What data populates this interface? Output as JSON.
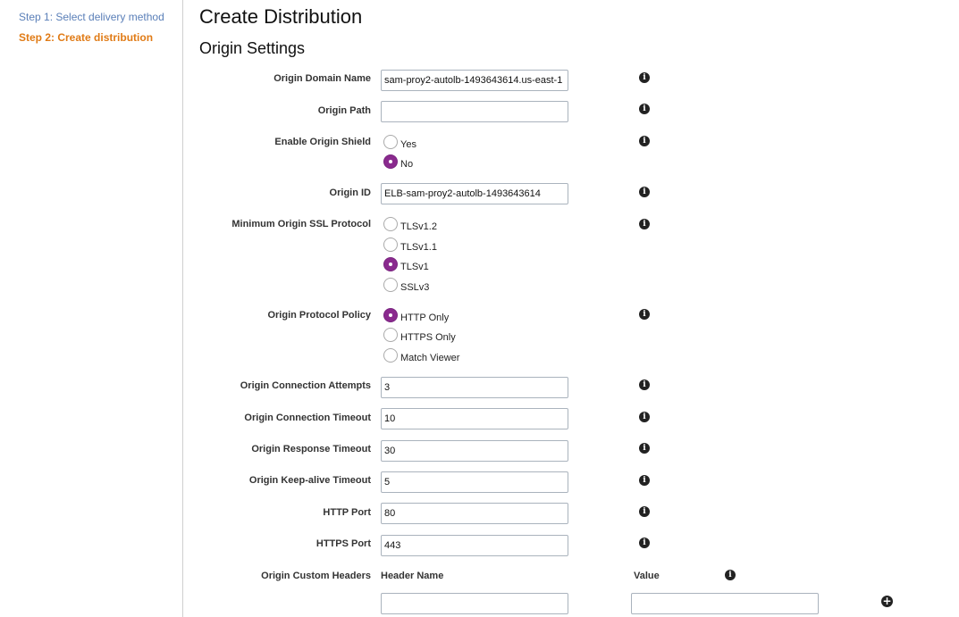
{
  "sidebar": {
    "step1": "Step 1: Select delivery method",
    "step2": "Step 2: Create distribution"
  },
  "page": {
    "title": "Create Distribution",
    "section": "Origin Settings"
  },
  "fields": {
    "origin_domain_name": {
      "label": "Origin Domain Name",
      "value": "sam-proy2-autolb-1493643614.us-east-1"
    },
    "origin_path": {
      "label": "Origin Path",
      "value": ""
    },
    "enable_origin_shield": {
      "label": "Enable Origin Shield",
      "options": [
        "Yes",
        "No"
      ],
      "selected": "No"
    },
    "origin_id": {
      "label": "Origin ID",
      "value": "ELB-sam-proy2-autolb-1493643614"
    },
    "min_ssl_protocol": {
      "label": "Minimum Origin SSL Protocol",
      "options": [
        "TLSv1.2",
        "TLSv1.1",
        "TLSv1",
        "SSLv3"
      ],
      "selected": "TLSv1"
    },
    "origin_protocol_policy": {
      "label": "Origin Protocol Policy",
      "options": [
        "HTTP Only",
        "HTTPS Only",
        "Match Viewer"
      ],
      "selected": "HTTP Only"
    },
    "connection_attempts": {
      "label": "Origin Connection Attempts",
      "value": "3"
    },
    "connection_timeout": {
      "label": "Origin Connection Timeout",
      "value": "10"
    },
    "response_timeout": {
      "label": "Origin Response Timeout",
      "value": "30"
    },
    "keepalive_timeout": {
      "label": "Origin Keep-alive Timeout",
      "value": "5"
    },
    "http_port": {
      "label": "HTTP Port",
      "value": "80"
    },
    "https_port": {
      "label": "HTTPS Port",
      "value": "443"
    },
    "custom_headers": {
      "label": "Origin Custom Headers",
      "header_name_label": "Header Name",
      "value_label": "Value",
      "header_name_value": "",
      "value_value": ""
    }
  },
  "icons": {
    "info": "info-icon",
    "add": "plus-circle-icon",
    "info_glyph": "i",
    "add_glyph": "+"
  },
  "colors": {
    "step_link": "#5a7fb8",
    "step_active": "#e07b16",
    "radio_checked": "#8a2a8e"
  }
}
